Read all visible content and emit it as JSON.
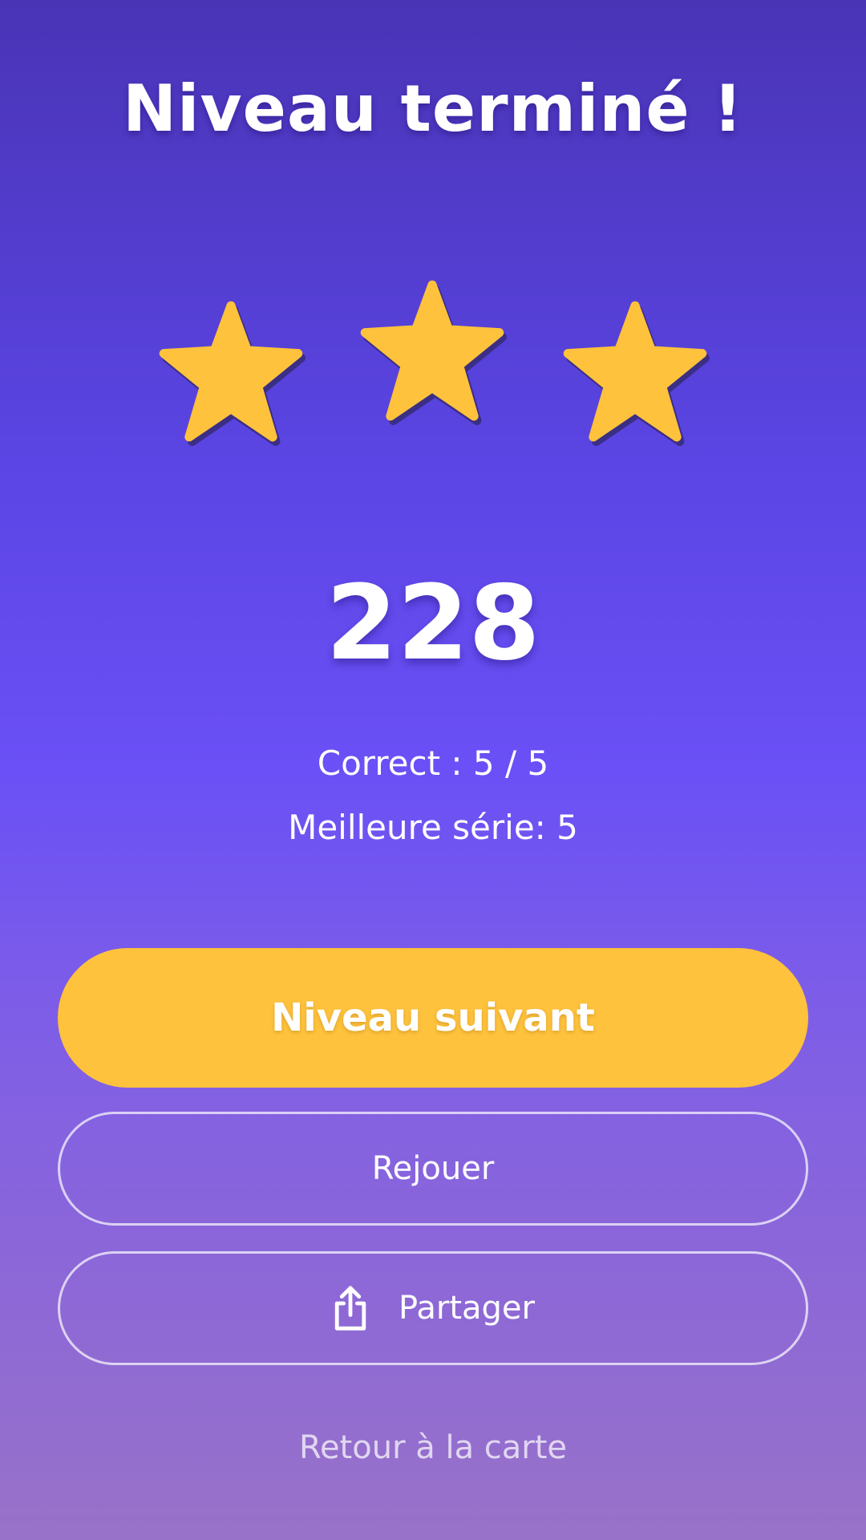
{
  "screen": {
    "title": "Niveau terminé !"
  },
  "rating": {
    "stars_earned": 3,
    "stars_total": 3,
    "star_color": "#fec23c",
    "star_shadow_color": "#4a3a8c"
  },
  "results": {
    "score": "228",
    "correct": "Correct : 5 / 5",
    "best_streak": "Meilleure série: 5"
  },
  "actions": {
    "next_level_label": "Niveau suivant",
    "replay_label": "Rejouer",
    "share_label": "Partager",
    "share_icon": "share-icon",
    "back_to_map_label": "Retour à la carte"
  },
  "theme": {
    "primary_button_color": "#fec23c",
    "background_top": "#4934b6",
    "background_bottom": "#9872c8"
  }
}
